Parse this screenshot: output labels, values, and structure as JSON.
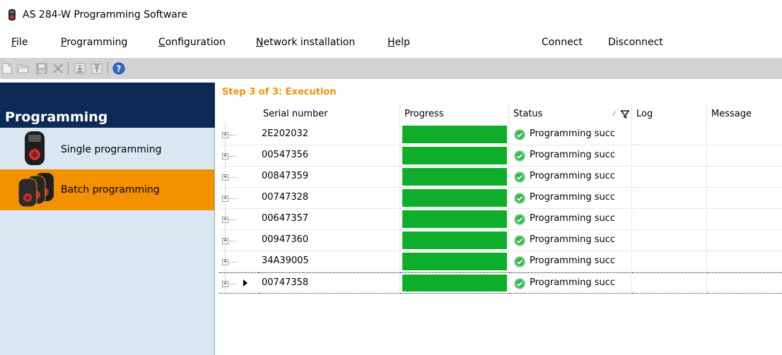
{
  "window": {
    "title": "AS 284-W Programming Software"
  },
  "menu": [
    {
      "pre": "",
      "u": "F",
      "post": "ile"
    },
    {
      "pre": "",
      "u": "P",
      "post": "rogramming"
    },
    {
      "pre": "",
      "u": "C",
      "post": "onfiguration"
    },
    {
      "pre": "",
      "u": "N",
      "post": "etwork installation"
    },
    {
      "pre": "",
      "u": "H",
      "post": "elp"
    }
  ],
  "connection": {
    "connect": "Connect",
    "disconnect": "Disconnect"
  },
  "sidebar": {
    "title": "Programming",
    "items": [
      {
        "label": "Single programming"
      },
      {
        "label": "Batch programming"
      }
    ]
  },
  "main": {
    "step_title": "Step 3 of 3: Execution",
    "columns": {
      "serial": "Serial number",
      "progress": "Progress",
      "status": "Status",
      "log": "Log",
      "message": "Message"
    },
    "rows": [
      {
        "serial": "2E202032",
        "progress": 1.0,
        "status": "Programming succ"
      },
      {
        "serial": "00547356",
        "progress": 1.0,
        "status": "Programming succ"
      },
      {
        "serial": "00847359",
        "progress": 1.0,
        "status": "Programming succ"
      },
      {
        "serial": "00747328",
        "progress": 1.0,
        "status": "Programming succ"
      },
      {
        "serial": "00647357",
        "progress": 1.0,
        "status": "Programming succ"
      },
      {
        "serial": "00947360",
        "progress": 1.0,
        "status": "Programming succ"
      },
      {
        "serial": "34A39005",
        "progress": 1.0,
        "status": "Programming succ"
      },
      {
        "serial": "00747358",
        "progress": 1.0,
        "status": "Programming succ"
      }
    ]
  },
  "colors": {
    "accent": "#f39100",
    "sidebar_header": "#0c2a55",
    "progress": "#0fae2a",
    "success": "#35b54a"
  },
  "icons": {
    "toolbar": [
      "new-icon",
      "open-icon",
      "save-icon",
      "delete-icon",
      "download-icon",
      "upload-icon",
      "help-icon"
    ]
  }
}
